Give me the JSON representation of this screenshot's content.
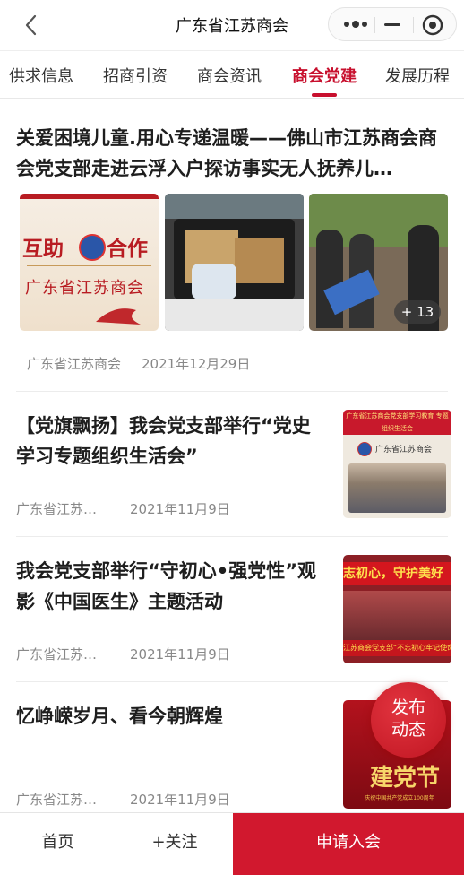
{
  "header": {
    "title": "广东省江苏商会"
  },
  "tabs": [
    {
      "label": "供求信息"
    },
    {
      "label": "招商引资"
    },
    {
      "label": "商会资讯"
    },
    {
      "label": "商会党建"
    },
    {
      "label": "发展历程"
    }
  ],
  "active_tab": "商会党建",
  "articles": [
    {
      "title": "关爱困境儿童.用心专递温暖——佛山市江苏商会商会党支部走进云浮入户探访事实无人抚养儿…",
      "source": "广东省江苏商会",
      "date": "2021年12月29日",
      "image1_text_top": "互助",
      "image1_text_top2": "合作",
      "image1_text_bottom": "广东省江苏商会",
      "more_images": "+ 13"
    },
    {
      "title": "【党旗飘扬】我会党支部举行“党史学习专题组织生活会”",
      "source": "广东省江苏…",
      "date": "2021年11月9日",
      "thumb_banner": "广东省江苏商会党支部学习教育 专题组织生活会",
      "thumb_text": "广东省江苏商会"
    },
    {
      "title": "我会党支部举行“守初心•强党性”观影《中国医生》主题活动",
      "source": "广东省江苏…",
      "date": "2021年11月9日",
      "thumb_banner": "志初心，守护美好",
      "thumb_bottom": "江苏商会党支部“不忘初心牢记使命”主题党"
    },
    {
      "title": "忆峥嵘岁月、看今朝辉煌",
      "source": "广东省江苏…",
      "date": "2021年11月9日",
      "thumb_text": "建党节",
      "thumb_sub": "庆祝中国共产党成立100周年"
    }
  ],
  "fab": {
    "line1": "发布",
    "line2": "动态"
  },
  "bottom_bar": {
    "home": "首页",
    "follow": "+关注",
    "apply": "申请入会"
  },
  "colors": {
    "accent": "#c8102e",
    "apply_bg": "#d1182e"
  }
}
